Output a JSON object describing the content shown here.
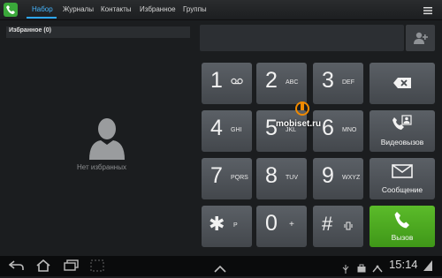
{
  "tabs": [
    {
      "label": "Набор"
    },
    {
      "label": "Журналы"
    },
    {
      "label": "Контакты"
    },
    {
      "label": "Избранное"
    },
    {
      "label": "Группы"
    }
  ],
  "favorites": {
    "header": "Избранное (0)",
    "empty_text": "Нет избранных"
  },
  "keypad": {
    "keys": [
      {
        "digit": "1",
        "sub": ""
      },
      {
        "digit": "2",
        "sub": "ABC"
      },
      {
        "digit": "3",
        "sub": "DEF"
      },
      {
        "digit": "4",
        "sub": "GHI"
      },
      {
        "digit": "5",
        "sub": "JKL"
      },
      {
        "digit": "6",
        "sub": "MNO"
      },
      {
        "digit": "7",
        "sub": "PQRS"
      },
      {
        "digit": "8",
        "sub": "TUV"
      },
      {
        "digit": "9",
        "sub": "WXYZ"
      },
      {
        "digit": "✱",
        "sub": "P"
      },
      {
        "digit": "0",
        "sub": "+"
      },
      {
        "digit": "#",
        "sub": ""
      }
    ]
  },
  "actions": {
    "video_call": "Видеовызов",
    "message": "Сообщение",
    "call": "Вызов"
  },
  "status": {
    "time": "15:14"
  },
  "watermark": "mobiset.ru",
  "colors": {
    "accent": "#2ea8ff",
    "call_green": "#4aa71f"
  }
}
